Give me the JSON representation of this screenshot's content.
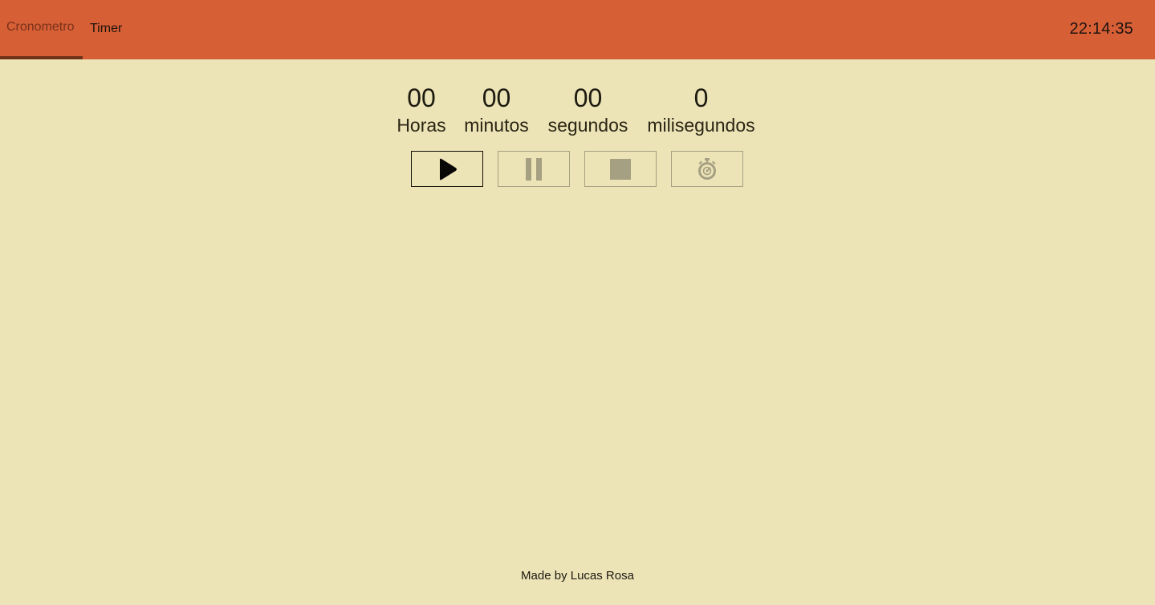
{
  "tabs": [
    {
      "label": "Cronometro",
      "active": true
    },
    {
      "label": "Timer",
      "active": false
    }
  ],
  "clock": "22:14:35",
  "display": {
    "hours": {
      "value": "00",
      "label": "Horas"
    },
    "minutes": {
      "value": "00",
      "label": "minutos"
    },
    "seconds": {
      "value": "00",
      "label": "segundos"
    },
    "milliseconds": {
      "value": "0",
      "label": "milisegundos"
    }
  },
  "controls": [
    {
      "icon": "play-icon",
      "enabled": true
    },
    {
      "icon": "pause-icon",
      "enabled": false
    },
    {
      "icon": "stop-icon",
      "enabled": false
    },
    {
      "icon": "stopwatch-lap-icon",
      "enabled": false
    }
  ],
  "footer": "Made by Lucas Rosa",
  "colors": {
    "header": "#d65f36",
    "background": "#ece3b7",
    "active_tab_underline": "#6e3118",
    "disabled": "#a6a082"
  }
}
